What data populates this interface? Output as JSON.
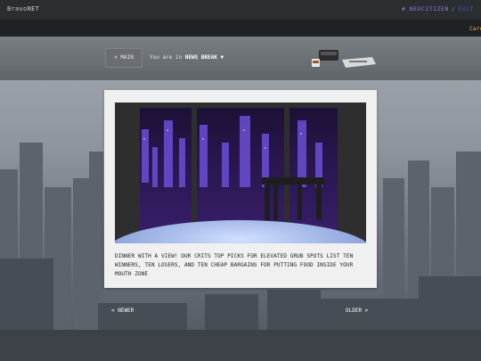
{
  "brand": "BravoNET",
  "account": {
    "handle": "# NEOCITIZEN",
    "separator": "/",
    "login": "EXIT"
  },
  "ticker": {
    "text": "Care"
  },
  "header": {
    "main_button": "< MAIN",
    "breadcrumb_prefix": "You are in",
    "section": "NEWS BREAK",
    "section_caret": "▼"
  },
  "article": {
    "caption": "DINNER WITH A VIEW! OUR CRITS TOP PICKS FOR ELEVATED GRUB SPOTS LIST TEN WINNERS, TEN LOSERS, AND TEN CHEAP BARGAINS FOR PUTTING FOOD INSIDE YOUR MOUTH ZONE"
  },
  "pager": {
    "newer": "< NEWER",
    "older": "OLDER >"
  },
  "colors": {
    "accent": "#8a7fe0",
    "login": "#4b4fd1",
    "ticker": "#e3b04a"
  }
}
